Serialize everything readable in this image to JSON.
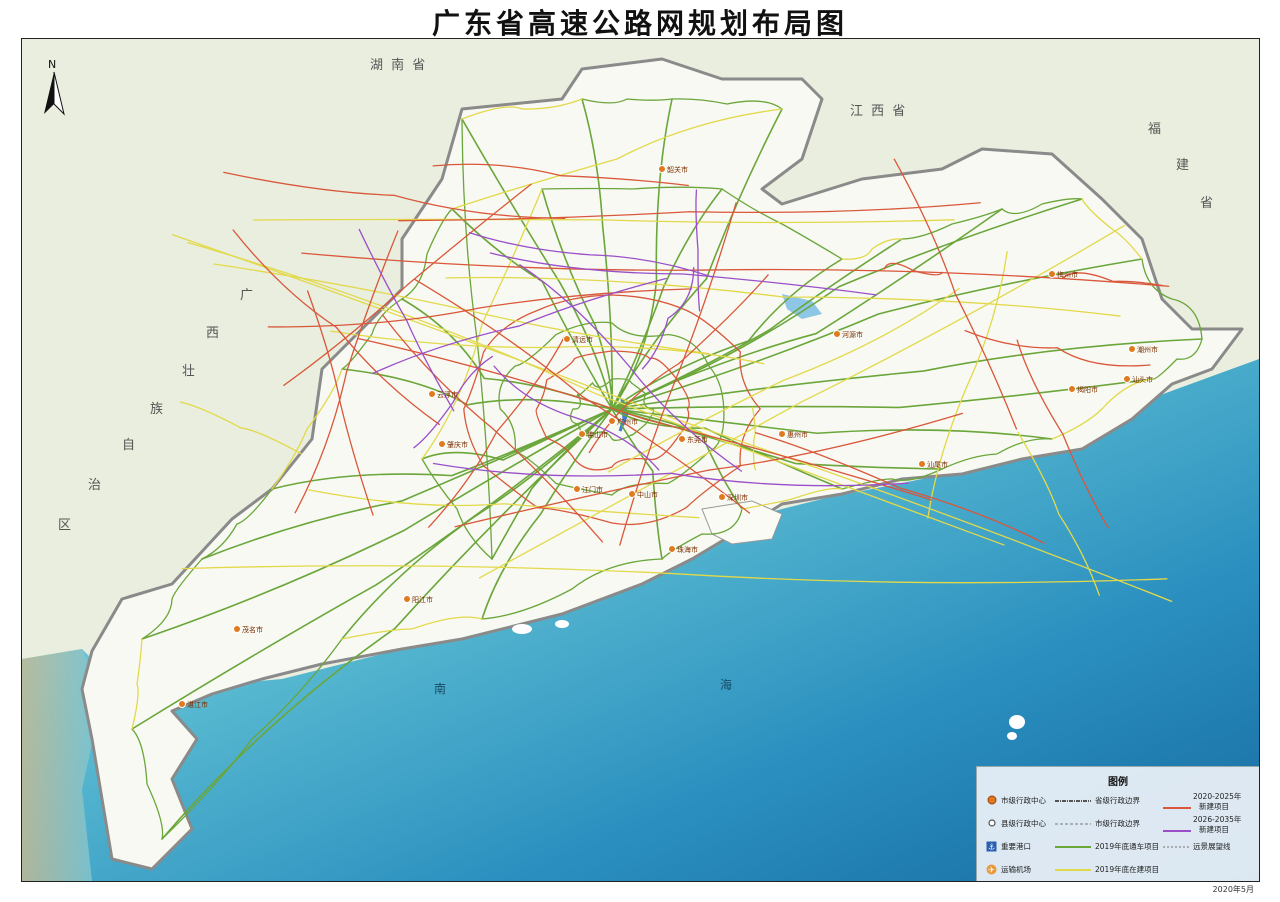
{
  "title": "广东省高速公路网规划布局图",
  "date": "2020年5月",
  "north_label": "N",
  "region_labels": {
    "hunan": "湖 南 省",
    "jiangxi": "江 西 省",
    "fujian": "福 建 省",
    "guangxi_1": "广",
    "guangxi_2": "西",
    "guangxi_3": "壮",
    "guangxi_4": "族",
    "guangxi_5": "自",
    "guangxi_6": "治",
    "guangxi_7": "区"
  },
  "sea_labels": {
    "nan": "南",
    "hai": "海"
  },
  "colors": {
    "sea_light": "#6fc3d6",
    "sea_deep": "#1b6fa8",
    "land": "#f7f8f2",
    "neighbor": "#e9eee0",
    "built": "#6aa63a",
    "under_construction": "#e2d94a",
    "new_2020_2025": "#d9573a",
    "new_2026_2035": "#9a4fc9",
    "city_marker": "#e07a20"
  },
  "legend": {
    "title": "图例",
    "city_center": "市级行政中心",
    "county_center": "县级行政中心",
    "major_port": "重要港口",
    "airport": "运输机场",
    "provincial_boundary": "省级行政边界",
    "city_boundary": "市级行政边界",
    "built_2019": "2019年底通车项目",
    "under_construction_2019": "2019年底在建项目",
    "new_2020_2025_a": "2020-2025年",
    "new_2020_2025_b": "新建项目",
    "new_2026_2035_a": "2026-2035年",
    "new_2026_2035_b": "新建项目",
    "long_term": "远景展望线"
  },
  "cities": [
    {
      "name": "广州市"
    },
    {
      "name": "深圳市"
    },
    {
      "name": "佛山市"
    },
    {
      "name": "东莞市"
    },
    {
      "name": "惠州市"
    },
    {
      "name": "中山市"
    },
    {
      "name": "珠海市"
    },
    {
      "name": "江门市"
    },
    {
      "name": "肇庆市"
    },
    {
      "name": "清远市"
    },
    {
      "name": "韶关市"
    },
    {
      "name": "河源市"
    },
    {
      "name": "梅州市"
    },
    {
      "name": "汕头市"
    },
    {
      "name": "潮州市"
    },
    {
      "name": "揭阳市"
    },
    {
      "name": "汕尾市"
    },
    {
      "name": "阳江市"
    },
    {
      "name": "茂名市"
    },
    {
      "name": "湛江市"
    },
    {
      "name": "云浮市"
    }
  ]
}
